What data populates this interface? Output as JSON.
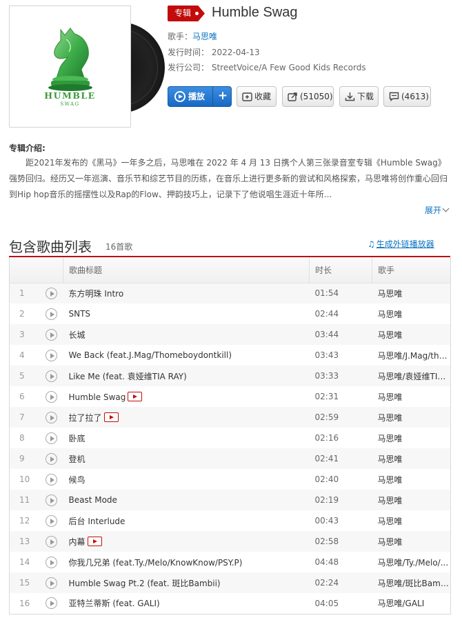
{
  "album": {
    "tag": "专辑",
    "title": "Humble Swag",
    "cover_title": "HUMBLE",
    "cover_sub": "SWAG",
    "artist_label": "歌手：",
    "artist": "马思唯",
    "release_label": "发行时间：",
    "release_date": "2022-04-13",
    "company_label": "发行公司：",
    "company": "StreetVoice/A Few Good Kids Records"
  },
  "actions": {
    "play_label": "播放",
    "add_label": "+",
    "collect_label": "收藏",
    "share_label": "(51050)",
    "download_label": "下载",
    "comment_label": "(4613)"
  },
  "intro": {
    "heading": "专辑介绍:",
    "text": "距2021年发布的《黑马》一年多之后，马思唯在 2022 年 4 月 13 日携个人第三张录音室专辑《Humble Swag》强势回归。经历又一年巡演、音乐节和综艺节目的历练，在音乐上进行更多新的尝试和风格探索，马思唯将创作重心回归到Hip hop音乐的摇摆性以及Rap的Flow、押韵技巧上，记录下了他说唱生涯近十年所...",
    "expand_label": "展开"
  },
  "list": {
    "heading": "包含歌曲列表",
    "count": "16首歌",
    "ext_link": "生成外链播放器",
    "columns": {
      "title": "歌曲标题",
      "duration": "时长",
      "artist": "歌手"
    },
    "songs": [
      {
        "num": "1",
        "title": "东方明珠 Intro",
        "duration": "01:54",
        "artist": "马思唯",
        "mv": false
      },
      {
        "num": "2",
        "title": "SNTS",
        "duration": "02:44",
        "artist": "马思唯",
        "mv": false
      },
      {
        "num": "3",
        "title": "长城",
        "duration": "03:44",
        "artist": "马思唯",
        "mv": false
      },
      {
        "num": "4",
        "title": "We Back (feat.J.Mag/Thomeboydontkill)",
        "duration": "03:43",
        "artist": "马思唯/J.Mag/tho...",
        "mv": false
      },
      {
        "num": "5",
        "title": "Like Me (feat. 袁娅维TIA RAY)",
        "duration": "03:33",
        "artist": "马思唯/袁娅维TIA...",
        "mv": false
      },
      {
        "num": "6",
        "title": "Humble Swag",
        "duration": "02:31",
        "artist": "马思唯",
        "mv": true
      },
      {
        "num": "7",
        "title": "拉了拉了",
        "duration": "02:59",
        "artist": "马思唯",
        "mv": true
      },
      {
        "num": "8",
        "title": "卧底",
        "duration": "02:16",
        "artist": "马思唯",
        "mv": false
      },
      {
        "num": "9",
        "title": "登机",
        "duration": "02:41",
        "artist": "马思唯",
        "mv": false
      },
      {
        "num": "10",
        "title": "候鸟",
        "duration": "02:40",
        "artist": "马思唯",
        "mv": false
      },
      {
        "num": "11",
        "title": "Beast Mode",
        "duration": "02:19",
        "artist": "马思唯",
        "mv": false
      },
      {
        "num": "12",
        "title": "后台 Interlude",
        "duration": "00:43",
        "artist": "马思唯",
        "mv": false
      },
      {
        "num": "13",
        "title": "内幕",
        "duration": "02:58",
        "artist": "马思唯",
        "mv": true
      },
      {
        "num": "14",
        "title": "你我几兄弟 (feat.Ty./Melo/KnowKnow/PSY.P)",
        "duration": "04:48",
        "artist": "马思唯/Ty./Melo/...",
        "mv": false
      },
      {
        "num": "15",
        "title": "Humble Swag Pt.2 (feat. 斑比Bambii)",
        "duration": "02:24",
        "artist": "马思唯/斑比Bambii",
        "mv": false
      },
      {
        "num": "16",
        "title": "亚特兰蒂斯 (feat. GALI)",
        "duration": "04:05",
        "artist": "马思唯/GALI",
        "mv": false
      }
    ]
  },
  "colors": {
    "accent_red": "#c20c0c",
    "link_blue": "#0c73c2",
    "cover_green": "#3a9a3a"
  }
}
